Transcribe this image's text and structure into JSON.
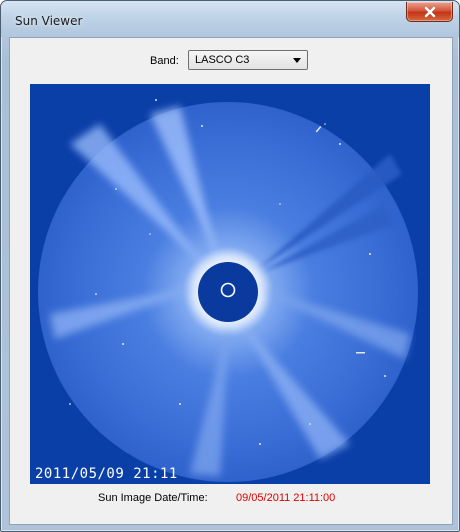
{
  "window": {
    "title": "Sun Viewer"
  },
  "band": {
    "label": "Band:",
    "selected": "LASCO C3"
  },
  "image": {
    "timestamp": "2011/05/09 21:11"
  },
  "date_time": {
    "label": "Sun Image Date/Time:",
    "value": "09/05/2011 21:11:00"
  },
  "colors": {
    "accent_value": "#e00000",
    "image_background": "#0b3fa8",
    "corona": "#3a72d8"
  }
}
